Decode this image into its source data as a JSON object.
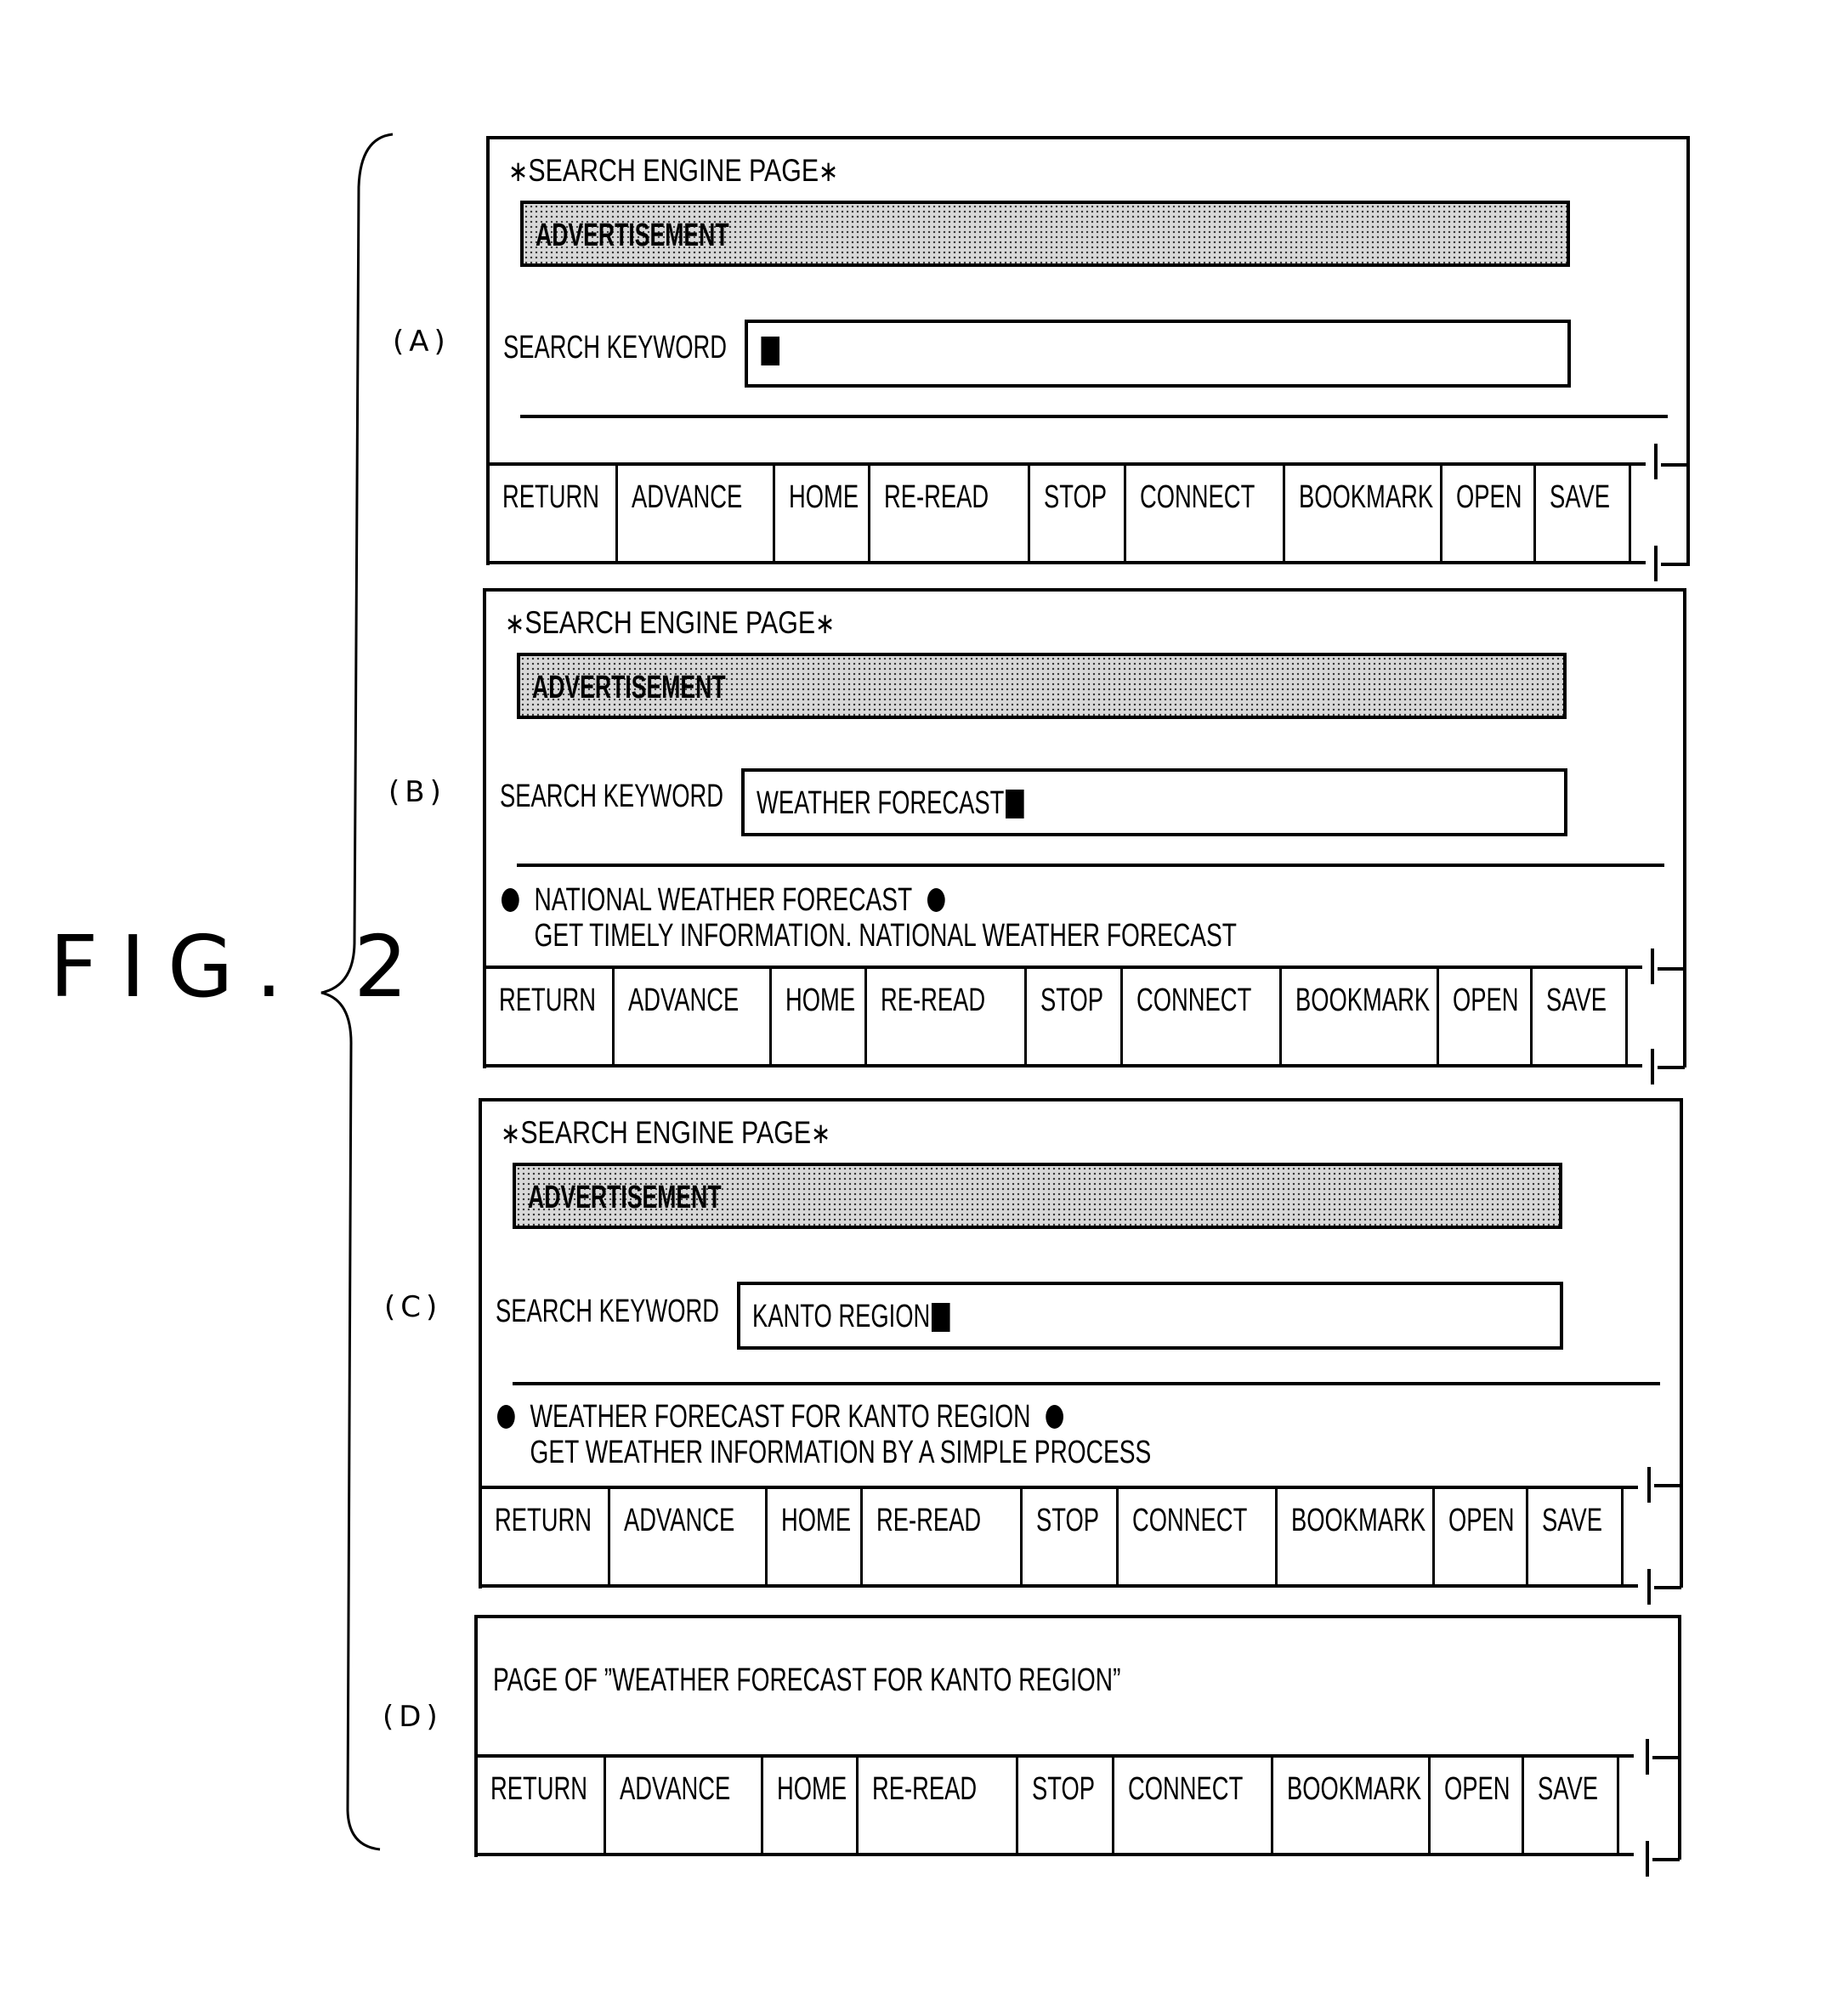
{
  "figure": {
    "label": "FIG. 2"
  },
  "toolbar_buttons": [
    {
      "id": "return",
      "label": "RETURN"
    },
    {
      "id": "advance",
      "label": "ADVANCE"
    },
    {
      "id": "home",
      "label": "HOME"
    },
    {
      "id": "re-read",
      "label": "RE-READ"
    },
    {
      "id": "stop",
      "label": "STOP"
    },
    {
      "id": "connect",
      "label": "CONNECT"
    },
    {
      "id": "bookmark",
      "label": "BOOKMARK"
    },
    {
      "id": "open",
      "label": "OPEN"
    },
    {
      "id": "save",
      "label": "SAVE"
    }
  ],
  "panels": {
    "a": {
      "label": "(A)",
      "title": "SEARCH ENGINE PAGE",
      "title_marker": "∗",
      "advertisement": "ADVERTISEMENT",
      "keyword_label": "SEARCH KEYWORD",
      "keyword_value": ""
    },
    "b": {
      "label": "(B)",
      "title": "SEARCH ENGINE PAGE",
      "title_marker": "∗",
      "advertisement": "ADVERTISEMENT",
      "keyword_label": "SEARCH KEYWORD",
      "keyword_value": "WEATHER FORECAST",
      "result": {
        "title": "NATIONAL WEATHER FORECAST",
        "description": "GET TIMELY INFORMATION. NATIONAL WEATHER FORECAST"
      }
    },
    "c": {
      "label": "(C)",
      "title": "SEARCH ENGINE PAGE",
      "title_marker": "∗",
      "advertisement": "ADVERTISEMENT",
      "keyword_label": "SEARCH KEYWORD",
      "keyword_value": "KANTO REGION",
      "result": {
        "title": "WEATHER FORECAST FOR KANTO REGION",
        "description": "GET WEATHER INFORMATION BY A SIMPLE PROCESS"
      }
    },
    "d": {
      "label": "(D)",
      "page_text": "PAGE OF ”WEATHER FORECAST FOR KANTO REGION”"
    }
  }
}
